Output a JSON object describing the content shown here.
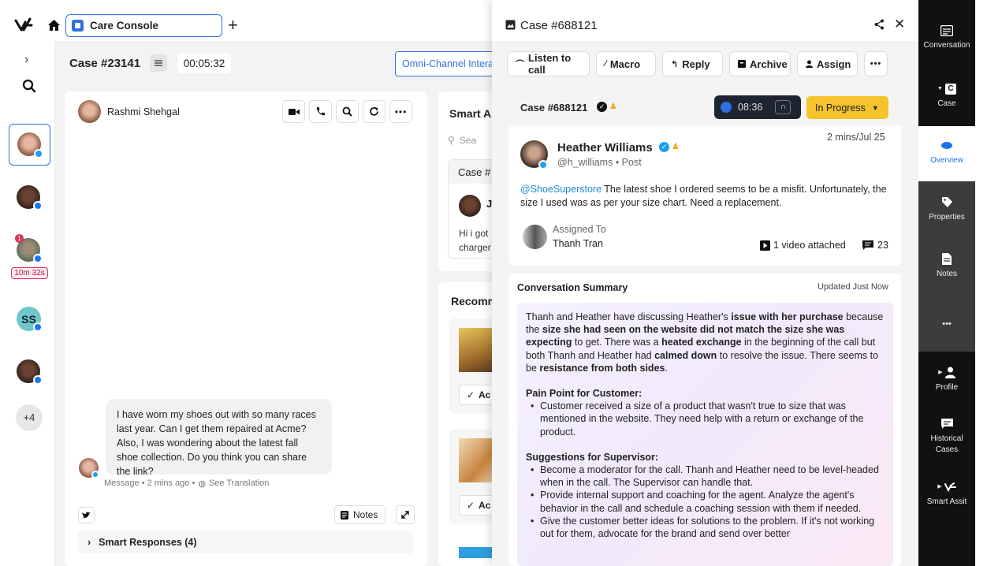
{
  "topbar": {
    "tab_label": "Care Console"
  },
  "rail": {
    "timer_badge": "10m 32s",
    "initials": "SS",
    "more_count": "+4"
  },
  "case": {
    "title": "Case #23141",
    "timer": "00:05:32",
    "omni_label": "Omni-Channel Intera"
  },
  "chat": {
    "user_name": "Rashmi Shehgal",
    "message": "I have worn my shoes out with so many races last year. Can I get them repaired at Acme? Also, I was wondering about the latest fall shoe collection. Do you think you can share the link?",
    "message_meta": "Message • 2 mins ago •",
    "see_translation": "See Translation",
    "notes_label": "Notes",
    "smart_responses": "Smart Responses (4)"
  },
  "smart_panel": {
    "title": "Smart A",
    "search_placeholder": "Sea",
    "case_label": "Case #",
    "preview_text_1": "Hi i got",
    "preview_text_2": "charger",
    "letter": "J",
    "recommend_title": "Recomm",
    "ac1": "Ac",
    "ac2": "Ac"
  },
  "panel": {
    "title": "Case #688121",
    "buttons": {
      "listen": "Listen to call",
      "macro": "Macro",
      "reply": "Reply",
      "archive": "Archive",
      "assign": "Assign"
    },
    "case_id": "Case #688121",
    "call_time": "08:36",
    "status": "In Progress",
    "user_name": "Heather Williams",
    "user_handle": "@h_williams • Post",
    "time": "2 mins/Jul 25",
    "mention": "@ShoeSuperstore",
    "post_text": " The latest shoe I ordered seems to be a misfit. Unfortunately, the size I used was as per your size chart. Need a replacement.",
    "assigned_label": "Assigned To",
    "assigned_name": "Thanh Tran",
    "video_label": "1 video attached",
    "comment_count": "23",
    "summary_title": "Conversation Summary",
    "summary_updated": "Updated Just Now",
    "summary": {
      "p1": "Thanh and Heather have discussing Heather's",
      "p1b": "issue with her purchase",
      "p2": "because the",
      "p2b": "size she had seen on the website did not match the size she was expecting",
      "p3": "to get. There was a",
      "p3b": "heated exchange",
      "p4": "in the beginning of the call but both Thanh and Heather had",
      "p4b": "calmed down",
      "p5": "to resolve the issue. There seems to be",
      "p5b": "resistance from both sides",
      "p6": ".",
      "pain_title": "Pain Point for Customer:",
      "pain_1": "Customer received a size of a product that wasn't true to size that was mentioned in the website. They need help with a return or exchange of the product.",
      "sugg_title": "Suggestions for Supervisor:",
      "sugg_1": "Become a moderator for the call. Thanh and Heather need to be level-headed when in the call. The Supervisor can handle that.",
      "sugg_2": "Provide internal support and coaching for the agent. Analyze the agent's behavior in the call and schedule a coaching session with them if needed.",
      "sugg_3": "Give the customer better ideas for solutions to the problem. If it's not working out for them, advocate for the brand and send over better"
    }
  },
  "right_nav": {
    "conversation": "Conversation",
    "case": "Case",
    "overview": "Overview",
    "properties": "Properties",
    "notes": "Notes",
    "more": "•••",
    "profile": "Profile",
    "historical_1": "Historical",
    "historical_2": "Cases",
    "smart_assist": "Smart Assit"
  },
  "colors": {
    "accent": "#2f6fe0",
    "status": "#f5c32c",
    "nav_bg": "#111111",
    "nav_active": "#ffffff",
    "nav_mid": "#3c3c3c"
  }
}
